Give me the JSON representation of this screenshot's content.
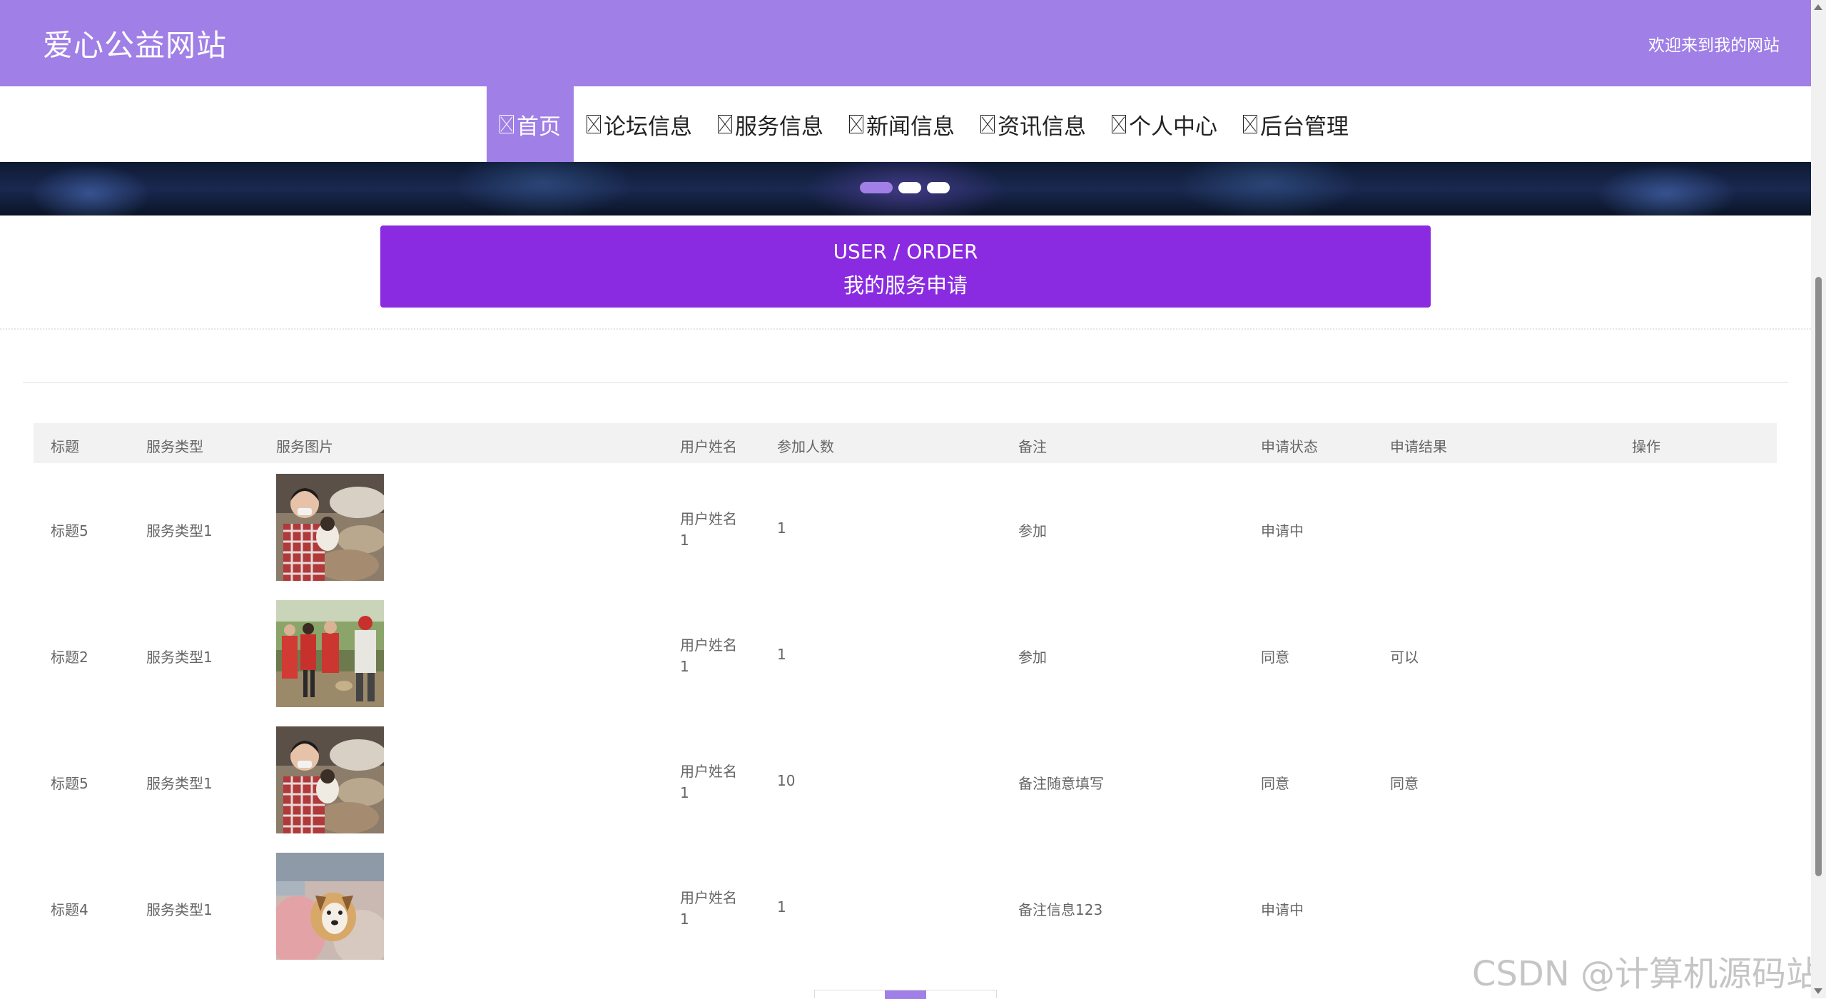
{
  "header": {
    "brand": "爱心公益网站",
    "welcome": "欢迎来到我的网站"
  },
  "nav": {
    "items": [
      {
        "label": "首页",
        "active": true
      },
      {
        "label": "论坛信息"
      },
      {
        "label": "服务信息"
      },
      {
        "label": "新闻信息"
      },
      {
        "label": "资讯信息"
      },
      {
        "label": "个人中心"
      },
      {
        "label": "后台管理"
      }
    ]
  },
  "banner": {
    "slide_count": 3,
    "active_slide": 1
  },
  "section": {
    "title_en": "USER / ORDER",
    "title_cn": "我的服务申请"
  },
  "table": {
    "headers": [
      "标题",
      "服务类型",
      "服务图片",
      "用户姓名",
      "参加人数",
      "备注",
      "申请状态",
      "申请结果",
      "操作"
    ],
    "rows": [
      {
        "title": "标题5",
        "type": "服务类型1",
        "user_line1": "用户姓名",
        "user_line2": "1",
        "count": "1",
        "note": "参加",
        "status": "申请中",
        "result": "",
        "image": "woman-with-dogs"
      },
      {
        "title": "标题2",
        "type": "服务类型1",
        "user_line1": "用户姓名",
        "user_line2": "1",
        "count": "1",
        "note": "参加",
        "status": "同意",
        "result": "可以",
        "image": "volunteers-outdoors"
      },
      {
        "title": "标题5",
        "type": "服务类型1",
        "user_line1": "用户姓名",
        "user_line2": "1",
        "count": "10",
        "note": "备注随意填写",
        "status": "同意",
        "result": "同意",
        "image": "woman-with-dogs"
      },
      {
        "title": "标题4",
        "type": "服务类型1",
        "user_line1": "用户姓名",
        "user_line2": "1",
        "count": "1",
        "note": "备注信息123",
        "status": "申请中",
        "result": "",
        "image": "person-holding-dog"
      }
    ]
  },
  "watermark": "CSDN @计算机源码站",
  "colors": {
    "header_bg": "#a07fe6",
    "title_box_bg": "#8a2be2",
    "table_head_bg": "#f2f2f2"
  }
}
